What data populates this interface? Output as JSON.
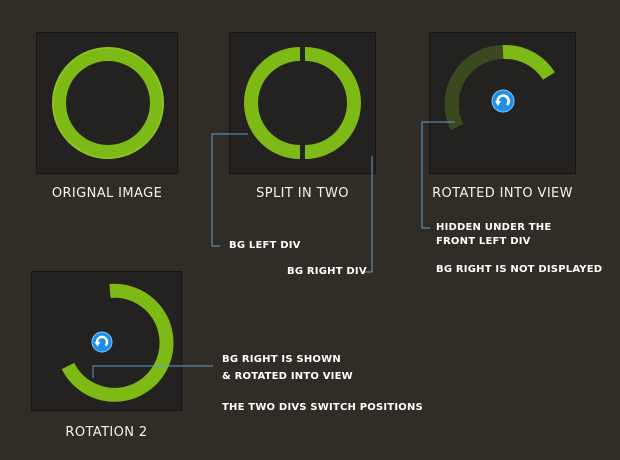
{
  "colors": {
    "background": "#312c26",
    "panel": "#232221",
    "ring_green": "#7dba16",
    "ring_dim": "#3a4a1e",
    "leader_line": "#5aa0d0",
    "icon_blue": "#1c8fe6"
  },
  "panels": {
    "original": {
      "caption": "ORIGNAL IMAGE"
    },
    "split": {
      "caption": "SPLIT IN TWO"
    },
    "rotated": {
      "caption": "ROTATED INTO VIEW"
    },
    "rotation2": {
      "caption": "ROTATION 2"
    }
  },
  "notes": {
    "bg_left_div": "BG LEFT DIV",
    "bg_right_div": "BG RIGHT DIV",
    "hidden_line1": "HIDDEN UNDER THE",
    "hidden_line2": "FRONT LEFT DIV",
    "bg_right_not_displayed": "BG RIGHT IS NOT DISPLAYED",
    "bg_right_shown_line1": "BG RIGHT IS SHOWN",
    "bg_right_shown_line2": "& ROTATED INTO VIEW",
    "two_divs_switch": "THE TWO DIVS SWITCH POSITIONS"
  },
  "icons": {
    "refresh": "refresh-icon"
  }
}
